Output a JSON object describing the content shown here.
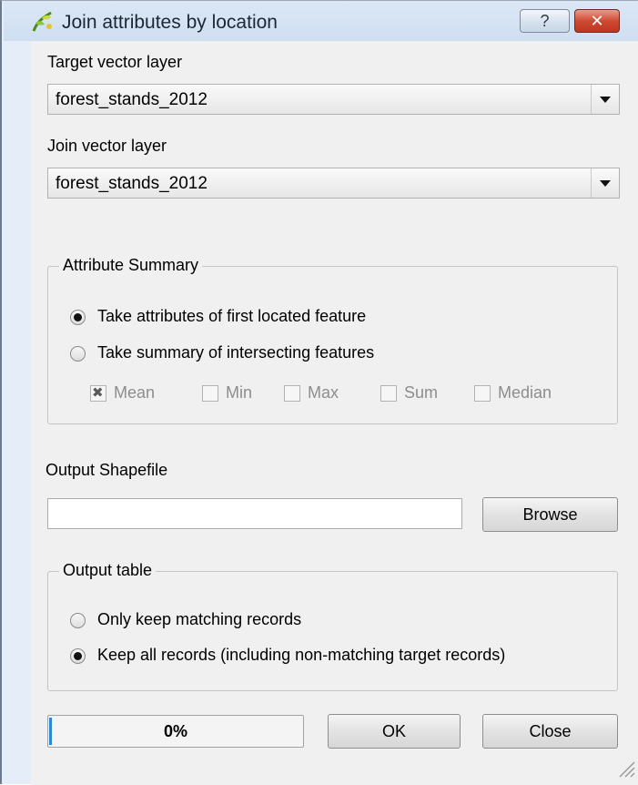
{
  "window": {
    "title": "Join attributes by location",
    "help_label": "?",
    "close_label": "✕"
  },
  "target": {
    "label": "Target vector layer",
    "value": "forest_stands_2012"
  },
  "join": {
    "label": "Join vector layer",
    "value": "forest_stands_2012"
  },
  "attribute_summary": {
    "title": "Attribute Summary",
    "options": [
      {
        "label": "Take attributes of first located feature",
        "checked": true
      },
      {
        "label": "Take summary of intersecting features",
        "checked": false
      }
    ],
    "stats": [
      {
        "label": "Mean",
        "checked": true
      },
      {
        "label": "Min",
        "checked": false
      },
      {
        "label": "Max",
        "checked": false
      },
      {
        "label": "Sum",
        "checked": false
      },
      {
        "label": "Median",
        "checked": false
      }
    ]
  },
  "output": {
    "label": "Output Shapefile",
    "value": "",
    "browse_label": "Browse"
  },
  "output_table": {
    "title": "Output table",
    "options": [
      {
        "label": "Only keep matching records",
        "checked": false
      },
      {
        "label": "Keep all records (including non-matching target records)",
        "checked": true
      }
    ]
  },
  "footer": {
    "progress_text": "0%",
    "progress_fraction": 0.0,
    "ok_label": "OK",
    "close_label": "Close"
  },
  "colors": {
    "progress_fill": "#2b87d8",
    "close_button": "#cf4a33",
    "titlebar": "#dbe7f5"
  },
  "icons": {
    "app": "qgis-logo-icon",
    "dropdown": "chevron-down-icon",
    "resize": "resize-grip-icon"
  }
}
